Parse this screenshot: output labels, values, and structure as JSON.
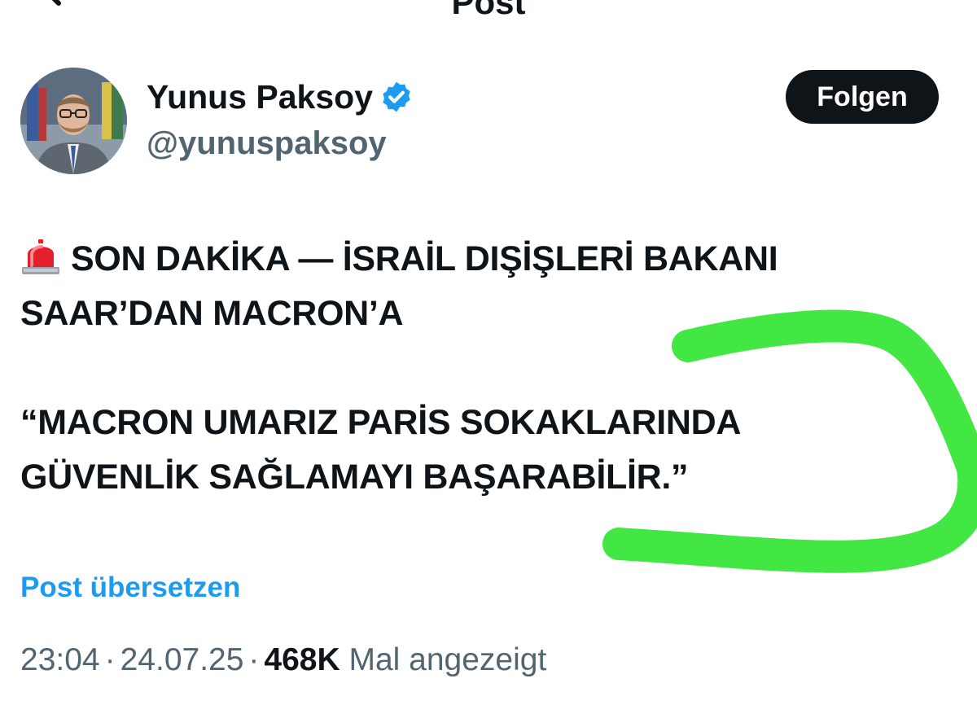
{
  "header": {
    "title": "Post",
    "back_icon": "back-arrow-icon",
    "more_icon": "more-options-icon"
  },
  "author": {
    "display_name": "Yunus Paksoy",
    "handle": "@yunuspaksoy",
    "verified_icon": "verified-badge-icon",
    "verified_color": "#1d9bf0",
    "follow_label": "Folgen"
  },
  "post": {
    "siren_icon": "police-light-emoji",
    "line1": "SON DAKİKA — İSRAİL DIŞİŞLERİ BAKANI",
    "line2": "SAAR’DAN MACRON’A",
    "line3": "“MACRON UMARIZ PARİS SOKAKLARINDA",
    "line4": "GÜVENLİK SAĞLAMAYI BAŞARABİLİR.”",
    "translate_label": "Post übersetzen"
  },
  "meta": {
    "time": "23:04",
    "date": "24.07.25",
    "views_count": "468K",
    "views_label": "Mal angezeigt",
    "separator": "·"
  },
  "colors": {
    "text": "#0f1419",
    "secondary": "#536471",
    "link": "#1d9bf0",
    "highlighter": "#39e639"
  }
}
